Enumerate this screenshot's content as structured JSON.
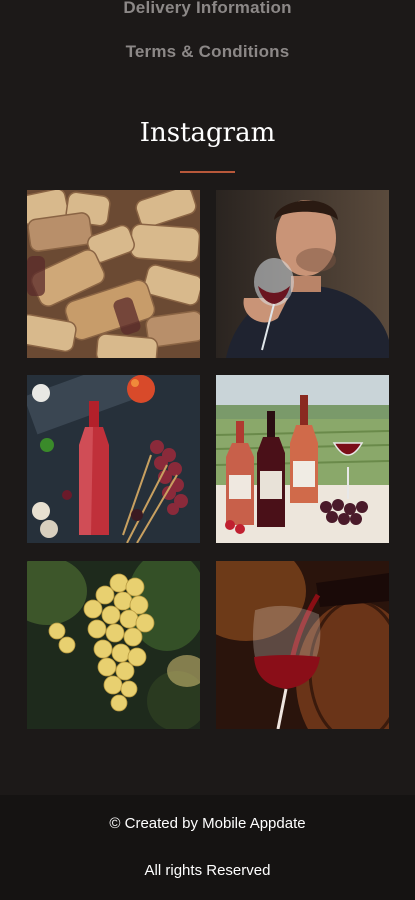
{
  "links": {
    "delivery": "Delivery Information",
    "terms": "Terms & Conditions"
  },
  "instagram": {
    "title": "Instagram",
    "accent_color": "#b8583a",
    "photos": [
      {
        "name": "wine-corks-photo"
      },
      {
        "name": "man-tasting-wine-photo"
      },
      {
        "name": "rose-wine-still-life-photo"
      },
      {
        "name": "wine-bottles-vineyard-photo"
      },
      {
        "name": "white-grapes-photo"
      },
      {
        "name": "red-wine-pouring-photo"
      }
    ]
  },
  "footer": {
    "credit": "© Created by Mobile Appdate",
    "rights": "All rights Reserved"
  }
}
